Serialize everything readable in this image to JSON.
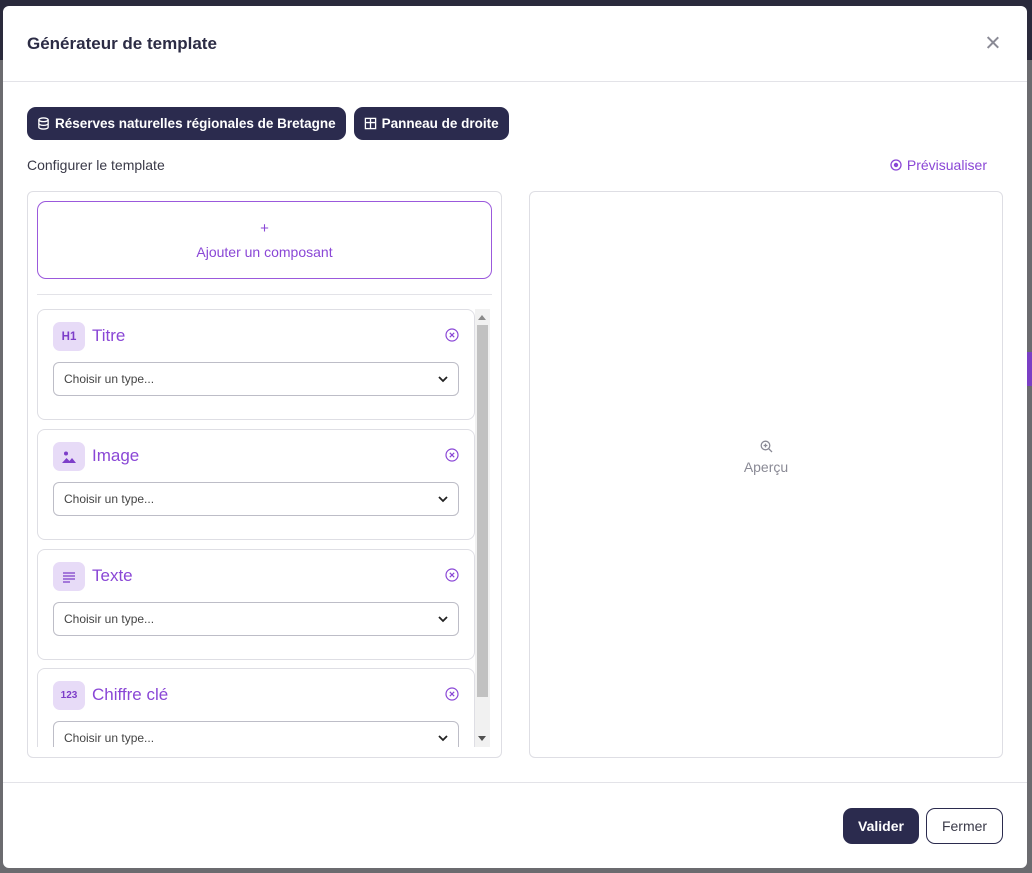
{
  "modal": {
    "title": "Générateur de template"
  },
  "chips": [
    {
      "label": "Réserves naturelles régionales de Bretagne",
      "icon": "database-icon"
    },
    {
      "label": "Panneau de droite",
      "icon": "layout-panel-icon"
    }
  ],
  "config": {
    "label": "Configurer le template",
    "preview_link": "Prévisualiser"
  },
  "add_component": {
    "plus": "+",
    "label": "Ajouter un composant"
  },
  "components": [
    {
      "badge": "H1",
      "name": "Titre",
      "icon": "heading-icon",
      "select_value": "Choisir un type..."
    },
    {
      "badge": "",
      "name": "Image",
      "icon": "image-icon",
      "select_value": "Choisir un type..."
    },
    {
      "badge": "",
      "name": "Texte",
      "icon": "text-lines-icon",
      "select_value": "Choisir un type..."
    },
    {
      "badge": "123",
      "name": "Chiffre clé",
      "icon": "number-icon",
      "select_value": "Choisir un type..."
    }
  ],
  "preview": {
    "label": "Aperçu"
  },
  "footer": {
    "validate": "Valider",
    "close": "Fermer"
  },
  "colors": {
    "accent": "#8a47d6",
    "dark": "#2b2b4e",
    "badge_bg": "#e7dbf7"
  }
}
